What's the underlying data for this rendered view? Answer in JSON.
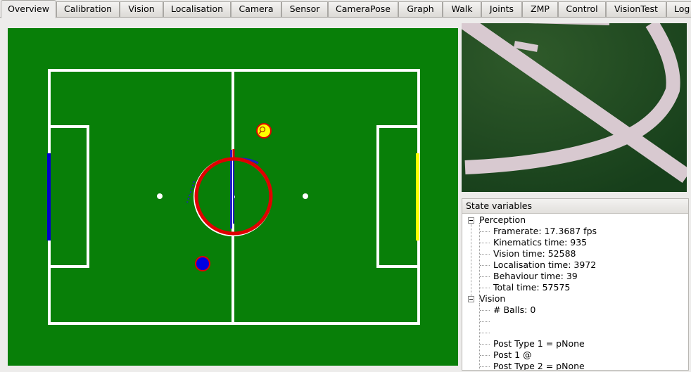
{
  "tabs": [
    {
      "label": "Overview",
      "active": true
    },
    {
      "label": "Calibration"
    },
    {
      "label": "Vision"
    },
    {
      "label": "Localisation"
    },
    {
      "label": "Camera"
    },
    {
      "label": "Sensor"
    },
    {
      "label": "CameraPose"
    },
    {
      "label": "Graph"
    },
    {
      "label": "Walk"
    },
    {
      "label": "Joints"
    },
    {
      "label": "ZMP"
    },
    {
      "label": "Control"
    },
    {
      "label": "VisionTest"
    },
    {
      "label": "Log"
    }
  ],
  "field": {
    "colors": {
      "grass": "#087f08",
      "lines": "#ffffff",
      "blue_goal": "#0000cc",
      "yellow_goal": "#ffff00",
      "robot": "#e00000",
      "ball_blue": "#0000e0",
      "ball_yellow": "#ffff00"
    }
  },
  "state_panel": {
    "title": "State variables",
    "groups": [
      {
        "name": "Perception",
        "items": [
          "Framerate: 17.3687 fps",
          "Kinematics time: 935",
          "Vision time: 52588",
          "Localisation time: 3972",
          "Behaviour time: 39",
          "Total time: 57575"
        ]
      },
      {
        "name": "Vision",
        "items": [
          "# Balls: 0",
          "",
          "",
          "Post Type 1 = pNone",
          "Post 1 @",
          "Post Type 2 = pNone"
        ]
      }
    ]
  }
}
